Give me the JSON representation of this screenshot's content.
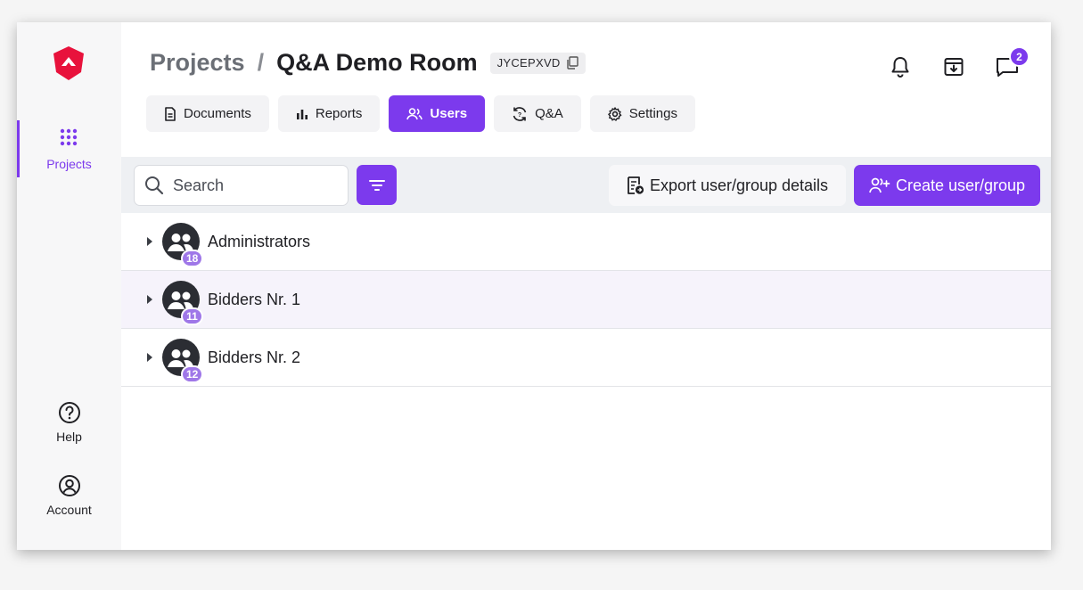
{
  "sidebar": {
    "logo": "brand-logo",
    "items": [
      {
        "label": "Projects",
        "icon": "grid-icon",
        "active": true
      }
    ],
    "bottom": [
      {
        "label": "Help",
        "icon": "help-circle-icon"
      },
      {
        "label": "Account",
        "icon": "account-circle-icon"
      }
    ]
  },
  "header": {
    "breadcrumb_parent": "Projects",
    "breadcrumb_separator": "/",
    "breadcrumb_current": "Q&A Demo Room",
    "room_code": "JYCEPXVD",
    "notifications_icon": "bell-icon",
    "archive_icon": "archive-download-icon",
    "messages_icon": "chat-icon",
    "messages_badge": "2"
  },
  "tabs": [
    {
      "label": "Documents",
      "icon": "document-icon",
      "active": false
    },
    {
      "label": "Reports",
      "icon": "bar-chart-icon",
      "active": false
    },
    {
      "label": "Users",
      "icon": "users-icon",
      "active": true
    },
    {
      "label": "Q&A",
      "icon": "qa-refresh-icon",
      "active": false
    },
    {
      "label": "Settings",
      "icon": "gear-icon",
      "active": false
    }
  ],
  "toolbar": {
    "search_placeholder": "Search",
    "search_value": "",
    "filter_icon": "filter-icon",
    "export_label": "Export user/group details",
    "create_label": "Create user/group"
  },
  "groups": [
    {
      "name": "Administrators",
      "count": "18",
      "highlighted": false
    },
    {
      "name": "Bidders Nr. 1",
      "count": "11",
      "highlighted": true
    },
    {
      "name": "Bidders Nr. 2",
      "count": "12",
      "highlighted": false
    }
  ],
  "colors": {
    "accent": "#7c3aed",
    "logo": "#e8123c",
    "count_badge": "#9f77e8",
    "row_highlight": "#f6f3fb"
  }
}
